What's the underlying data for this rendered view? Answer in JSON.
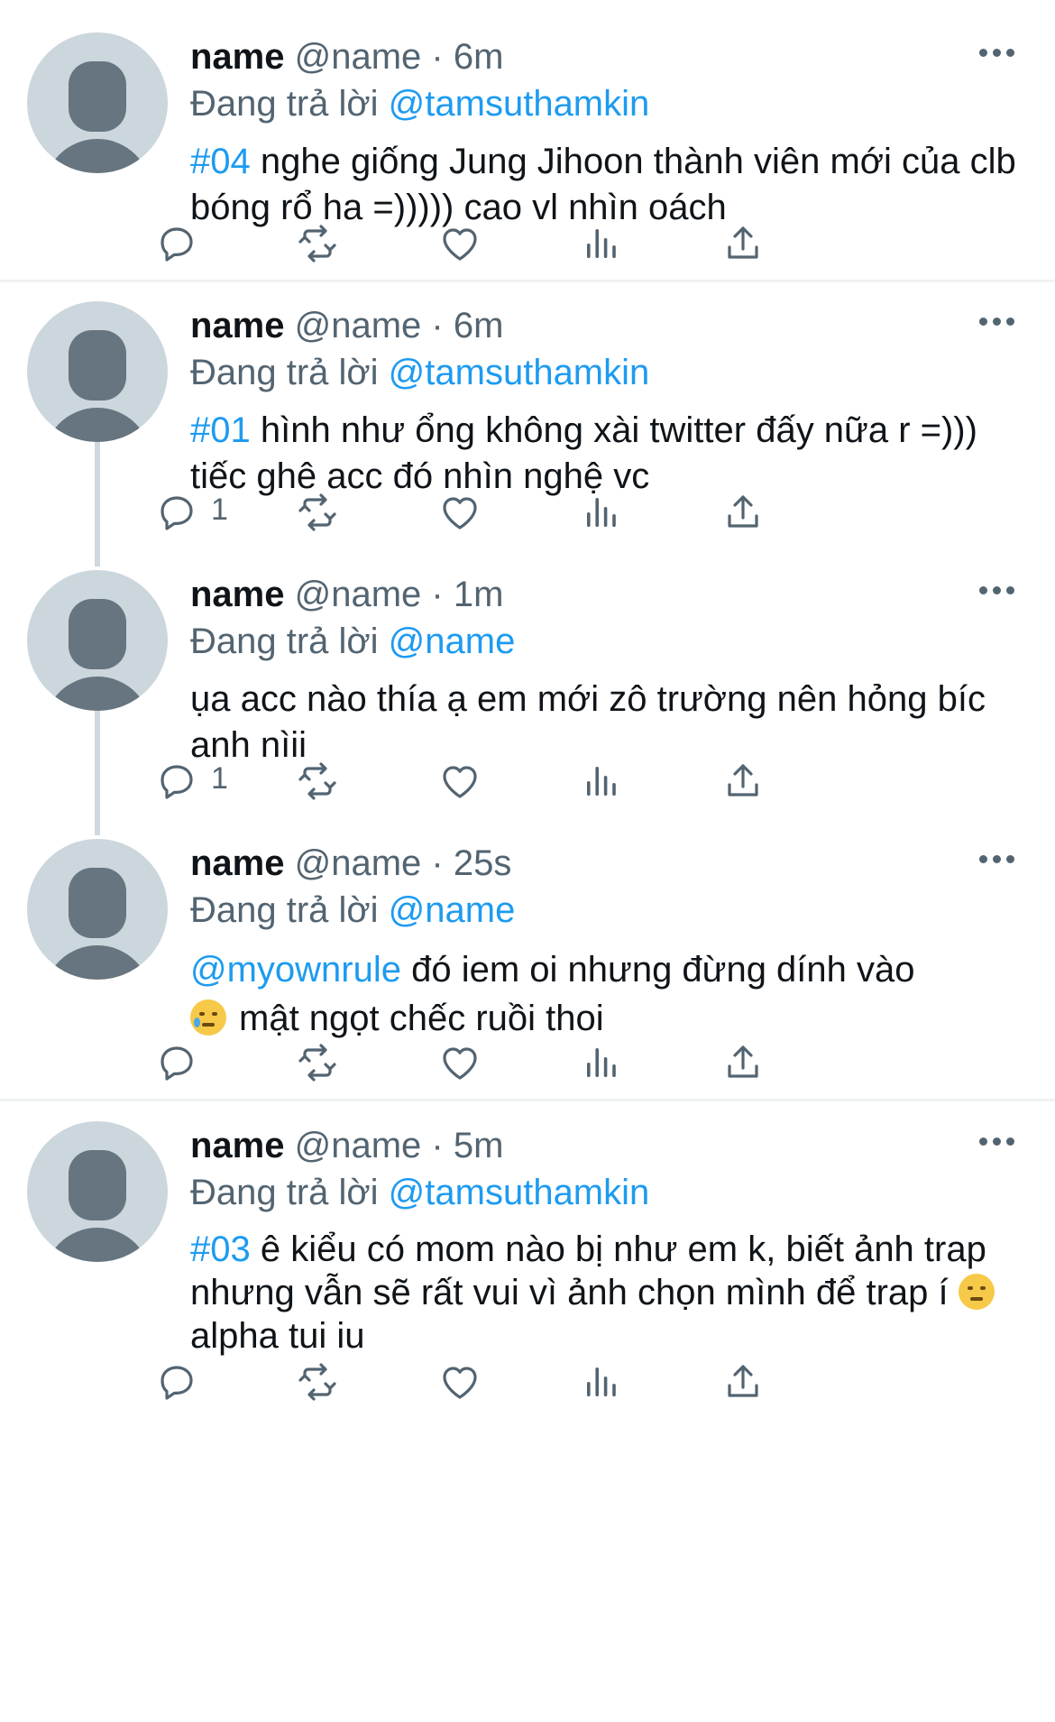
{
  "tweets": [
    {
      "name": "name",
      "meta": "@name · 6m",
      "replying_prefix": "Đang trả lời",
      "replying_to": "@tamsuthamkin",
      "body_lead": "#04",
      "body_text": " nghe giống Jung Jihoon thành viên mới của clb bóng rổ ha =))))) cao vl nhìn oách",
      "reply_count": ""
    },
    {
      "name": "name",
      "meta": "@name · 6m",
      "replying_prefix": "Đang trả lời",
      "replying_to": "@tamsuthamkin",
      "body_lead": "#01",
      "body_text": " hình như ổng không xài twitter đấy nữa r =))) tiếc ghê acc đó nhìn nghệ vc",
      "reply_count": "1"
    },
    {
      "name": "name",
      "meta": "@name · 1m",
      "replying_prefix": "Đang trả lời",
      "replying_to": "@name",
      "body_lead": "",
      "body_text": "ụa acc nào thía ạ em mới zô trường nên hỏng bíc anh nìii",
      "reply_count": "1"
    },
    {
      "name": "name",
      "meta": "@name · 25s",
      "replying_prefix": "Đang trả lời",
      "replying_to": "@name",
      "body_lead": "@myownrule",
      "body_text": " đó iem oi nhưng đừng dính vào",
      "body_line2": "mật ngọt chếc ruồi thoi",
      "reply_count": ""
    },
    {
      "name": "name",
      "meta": "@name · 5m",
      "replying_prefix": "Đang trả lời",
      "replying_to": "@tamsuthamkin",
      "body_lead": "#03",
      "body_text": " ê kiểu có mom nào bị như em k, biết ảnh trap nhưng vẫn sẽ rất vui vì ảnh chọn mình để",
      "body_line2_a": "trap í",
      "body_line2_b": "alpha tui iu",
      "reply_count": ""
    }
  ],
  "icons": {
    "reply": "reply-icon",
    "retweet": "retweet-icon",
    "like": "heart-icon",
    "views": "views-icon",
    "share": "share-icon",
    "more": "more-icon"
  },
  "colors": {
    "link": "#1d9bf0",
    "secondary": "#536471",
    "avatar_bg": "#ccd6dd",
    "avatar_fg": "#66757f"
  }
}
